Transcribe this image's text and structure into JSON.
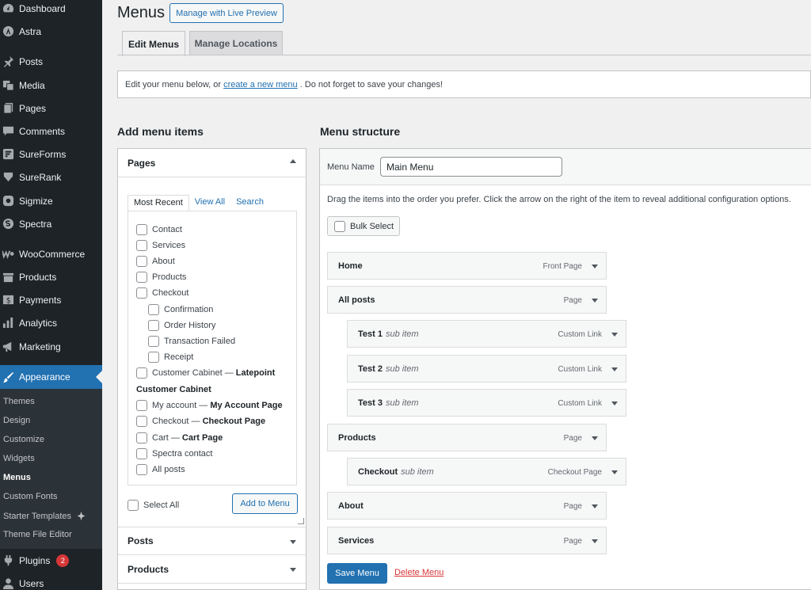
{
  "sidebar": {
    "items": [
      {
        "label": "Dashboard",
        "icon": "dashboard-icon"
      },
      {
        "label": "Astra",
        "icon": "astra-icon"
      },
      {
        "label": "Posts",
        "icon": "pin-icon"
      },
      {
        "label": "Media",
        "icon": "media-icon"
      },
      {
        "label": "Pages",
        "icon": "pages-icon"
      },
      {
        "label": "Comments",
        "icon": "comment-icon"
      },
      {
        "label": "SureForms",
        "icon": "sureforms-icon"
      },
      {
        "label": "SureRank",
        "icon": "surerank-icon"
      },
      {
        "label": "Sigmize",
        "icon": "sigmize-icon"
      },
      {
        "label": "Spectra",
        "icon": "spectra-icon"
      },
      {
        "label": "WooCommerce",
        "icon": "woocommerce-icon"
      },
      {
        "label": "Products",
        "icon": "products-icon"
      },
      {
        "label": "Payments",
        "icon": "payments-icon"
      },
      {
        "label": "Analytics",
        "icon": "analytics-icon"
      },
      {
        "label": "Marketing",
        "icon": "megaphone-icon"
      },
      {
        "label": "Appearance",
        "icon": "brush-icon"
      },
      {
        "label": "Plugins",
        "icon": "plug-icon",
        "badge": "2"
      },
      {
        "label": "Users",
        "icon": "users-icon"
      }
    ],
    "submenu": [
      "Themes",
      "Design",
      "Customize",
      "Widgets",
      "Menus",
      "Custom Fonts",
      "Starter Templates",
      "Theme File Editor"
    ]
  },
  "header": {
    "title": "Menus",
    "live_preview": "Manage with Live Preview",
    "tabs": [
      "Edit Menus",
      "Manage Locations"
    ]
  },
  "notice": {
    "before": "Edit your menu below, or",
    "link": "create a new menu",
    "after": ". Do not forget to save your changes!"
  },
  "add_items": {
    "heading": "Add menu items",
    "pages_title": "Pages",
    "inner_tabs": [
      "Most Recent",
      "View All",
      "Search"
    ],
    "pages": [
      {
        "label": "Contact",
        "indent": 0
      },
      {
        "label": "Services",
        "indent": 0
      },
      {
        "label": "About",
        "indent": 0
      },
      {
        "label": "Products",
        "indent": 0
      },
      {
        "label": "Checkout",
        "indent": 0
      },
      {
        "label": "Confirmation",
        "indent": 1
      },
      {
        "label": "Order History",
        "indent": 1
      },
      {
        "label": "Transaction Failed",
        "indent": 1
      },
      {
        "label": "Receipt",
        "indent": 1
      },
      {
        "label": "Customer Cabinet — ",
        "bold": "Latepoint",
        "indent": 0
      }
    ],
    "group_label": "Customer Cabinet",
    "pages2": [
      {
        "label": "My account — ",
        "bold": "My Account Page"
      },
      {
        "label": "Checkout — ",
        "bold": "Checkout Page"
      },
      {
        "label": "Cart — ",
        "bold": "Cart Page"
      },
      {
        "label": "Spectra contact",
        "bold": ""
      },
      {
        "label": "All posts",
        "bold": ""
      }
    ],
    "select_all": "Select All",
    "add_button": "Add to Menu",
    "posts_title": "Posts",
    "products_title": "Products"
  },
  "structure": {
    "heading": "Menu structure",
    "name_label": "Menu Name",
    "name_value": "Main Menu",
    "instructions": "Drag the items into the order you prefer. Click the arrow on the right of the item to reveal additional configuration options.",
    "bulk_select": "Bulk Select",
    "items": [
      {
        "title": "Home",
        "sub": "",
        "type": "Front Page",
        "depth": 0
      },
      {
        "title": "All posts",
        "sub": "",
        "type": "Page",
        "depth": 0
      },
      {
        "title": "Test 1",
        "sub": "sub item",
        "type": "Custom Link",
        "depth": 1
      },
      {
        "title": "Test 2",
        "sub": "sub item",
        "type": "Custom Link",
        "depth": 1
      },
      {
        "title": "Test 3",
        "sub": "sub item",
        "type": "Custom Link",
        "depth": 1
      },
      {
        "title": "Products",
        "sub": "",
        "type": "Page",
        "depth": 0
      },
      {
        "title": "Checkout",
        "sub": "sub item",
        "type": "Checkout Page",
        "depth": 1
      },
      {
        "title": "About",
        "sub": "",
        "type": "Page",
        "depth": 0
      },
      {
        "title": "Services",
        "sub": "",
        "type": "Page",
        "depth": 0
      }
    ],
    "save": "Save Menu",
    "delete": "Delete Menu"
  },
  "colors": {
    "accent": "#2271b1",
    "sidebar": "#1d2327",
    "danger": "#d63638"
  }
}
